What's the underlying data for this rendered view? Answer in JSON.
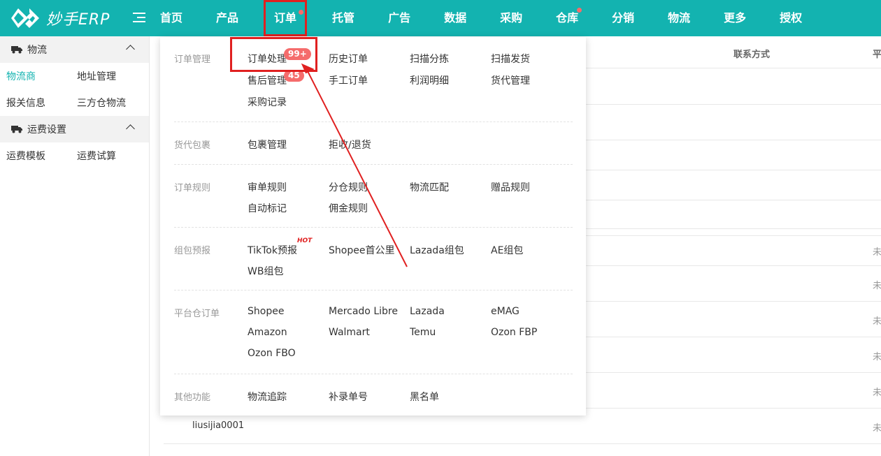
{
  "app": {
    "logo_text": "妙手ERP"
  },
  "colors": {
    "brand": "#13b3b0",
    "alert": "#f56c6c",
    "annotation": "#e02020"
  },
  "nav": {
    "items": [
      {
        "label": "首页",
        "dot": false,
        "active": false
      },
      {
        "label": "产品",
        "dot": false,
        "active": false
      },
      {
        "label": "订单",
        "dot": true,
        "active": true
      },
      {
        "label": "托管",
        "dot": false,
        "active": false
      },
      {
        "label": "广告",
        "dot": false,
        "active": false
      },
      {
        "label": "数据",
        "dot": false,
        "active": false
      },
      {
        "label": "采购",
        "dot": false,
        "active": false
      },
      {
        "label": "仓库",
        "dot": true,
        "active": false
      },
      {
        "label": "分销",
        "dot": false,
        "active": false
      },
      {
        "label": "物流",
        "dot": false,
        "active": false
      },
      {
        "label": "更多",
        "dot": false,
        "active": false
      },
      {
        "label": "授权",
        "dot": false,
        "active": false
      }
    ]
  },
  "sidebar": {
    "group1": {
      "label": "物流",
      "items": [
        "物流商",
        "地址管理",
        "报关信息",
        "三方仓物流"
      ],
      "active_index": 0
    },
    "group2": {
      "label": "运费设置",
      "items": [
        "运费模板",
        "运费试算"
      ]
    }
  },
  "table": {
    "headers": [
      "联系方式",
      "平"
    ],
    "row_statuses": [
      "未",
      "未",
      "未",
      "未",
      "未",
      "未"
    ],
    "last_row_name": "liusijia0001"
  },
  "dropdown": {
    "sections": [
      {
        "title": "订单管理",
        "items": [
          "订单处理",
          "历史订单",
          "扫描分拣",
          "扫描发货",
          "售后管理",
          "手工订单",
          "利润明细",
          "货代管理",
          "采购记录"
        ]
      },
      {
        "title": "货代包裹",
        "items": [
          "包裹管理",
          "拒收/退货"
        ]
      },
      {
        "title": "订单规则",
        "items": [
          "审单规则",
          "分仓规则",
          "物流匹配",
          "赠品规则",
          "自动标记",
          "佣金规则"
        ]
      },
      {
        "title": "组包预报",
        "items": [
          "TikTok预报",
          "Shopee首公里",
          "Lazada组包",
          "AE组包",
          "WB组包"
        ]
      },
      {
        "title": "平台仓订单",
        "items": [
          "Shopee",
          "Mercado Libre",
          "Lazada",
          "eMAG",
          "Amazon",
          "Walmart",
          "Temu",
          "Ozon FBP",
          "Ozon FBO"
        ]
      },
      {
        "title": "其他功能",
        "items": [
          "物流追踪",
          "补录单号",
          "黑名单"
        ]
      }
    ],
    "badges": {
      "order_processing": "99+",
      "after_sales": "45"
    },
    "hot_tag": "HOT"
  }
}
